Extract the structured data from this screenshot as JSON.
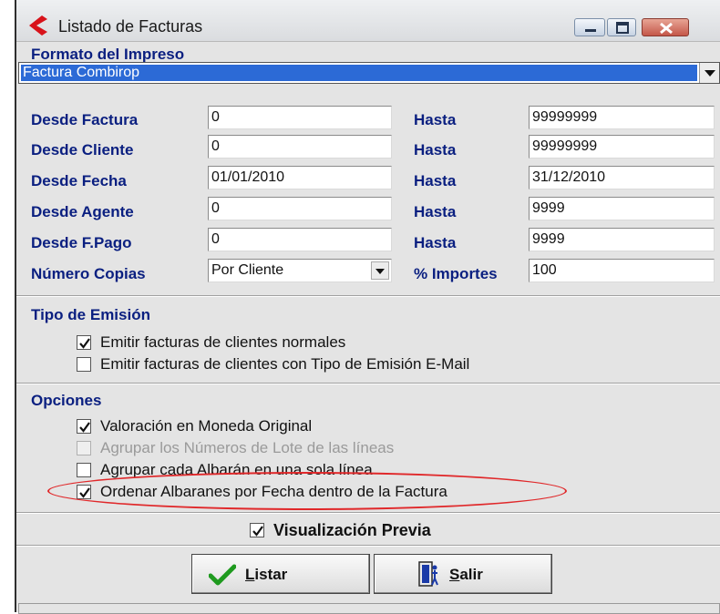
{
  "window": {
    "title": "Listado de Facturas"
  },
  "format": {
    "section_title": "Formato del Impreso",
    "selected": "Factura Combirop"
  },
  "ranges": [
    {
      "from_label": "Desde Factura",
      "from_value": "0",
      "to_label": "Hasta",
      "to_value": "99999999"
    },
    {
      "from_label": "Desde Cliente",
      "from_value": "0",
      "to_label": "Hasta",
      "to_value": "99999999"
    },
    {
      "from_label": "Desde Fecha",
      "from_value": "01/01/2010",
      "to_label": "Hasta",
      "to_value": "31/12/2010"
    },
    {
      "from_label": "Desde Agente",
      "from_value": "0",
      "to_label": "Hasta",
      "to_value": "9999"
    },
    {
      "from_label": "Desde F.Pago",
      "from_value": "0",
      "to_label": "Hasta",
      "to_value": "9999"
    }
  ],
  "copies": {
    "label": "Número Copias",
    "selected": "Por Cliente",
    "importes_label": "% Importes",
    "importes_value": "100"
  },
  "tipo_emision": {
    "title": "Tipo de Emisión",
    "options": [
      {
        "label": "Emitir facturas de clientes normales",
        "checked": true
      },
      {
        "label": "Emitir facturas de clientes con Tipo de Emisión E-Mail",
        "checked": false
      }
    ]
  },
  "opciones": {
    "title": "Opciones",
    "options": [
      {
        "label": "Valoración en Moneda Original",
        "checked": true,
        "enabled": true
      },
      {
        "label": "Agrupar los Números de Lote de las líneas",
        "checked": false,
        "enabled": false
      },
      {
        "label": "Agrupar cada Albarán en una sola línea",
        "checked": false,
        "enabled": true
      },
      {
        "label": "Ordenar Albaranes por Fecha dentro de la Factura",
        "checked": true,
        "enabled": true
      }
    ]
  },
  "preview": {
    "label": "Visualización Previa",
    "checked": true
  },
  "buttons": {
    "listar_u": "L",
    "listar_rest": "istar",
    "salir_u": "S",
    "salir_rest": "alir"
  },
  "colors": {
    "label_blue": "#0a1f80",
    "selection_blue": "#2c6ad6",
    "highlight_red": "#e0282a"
  }
}
